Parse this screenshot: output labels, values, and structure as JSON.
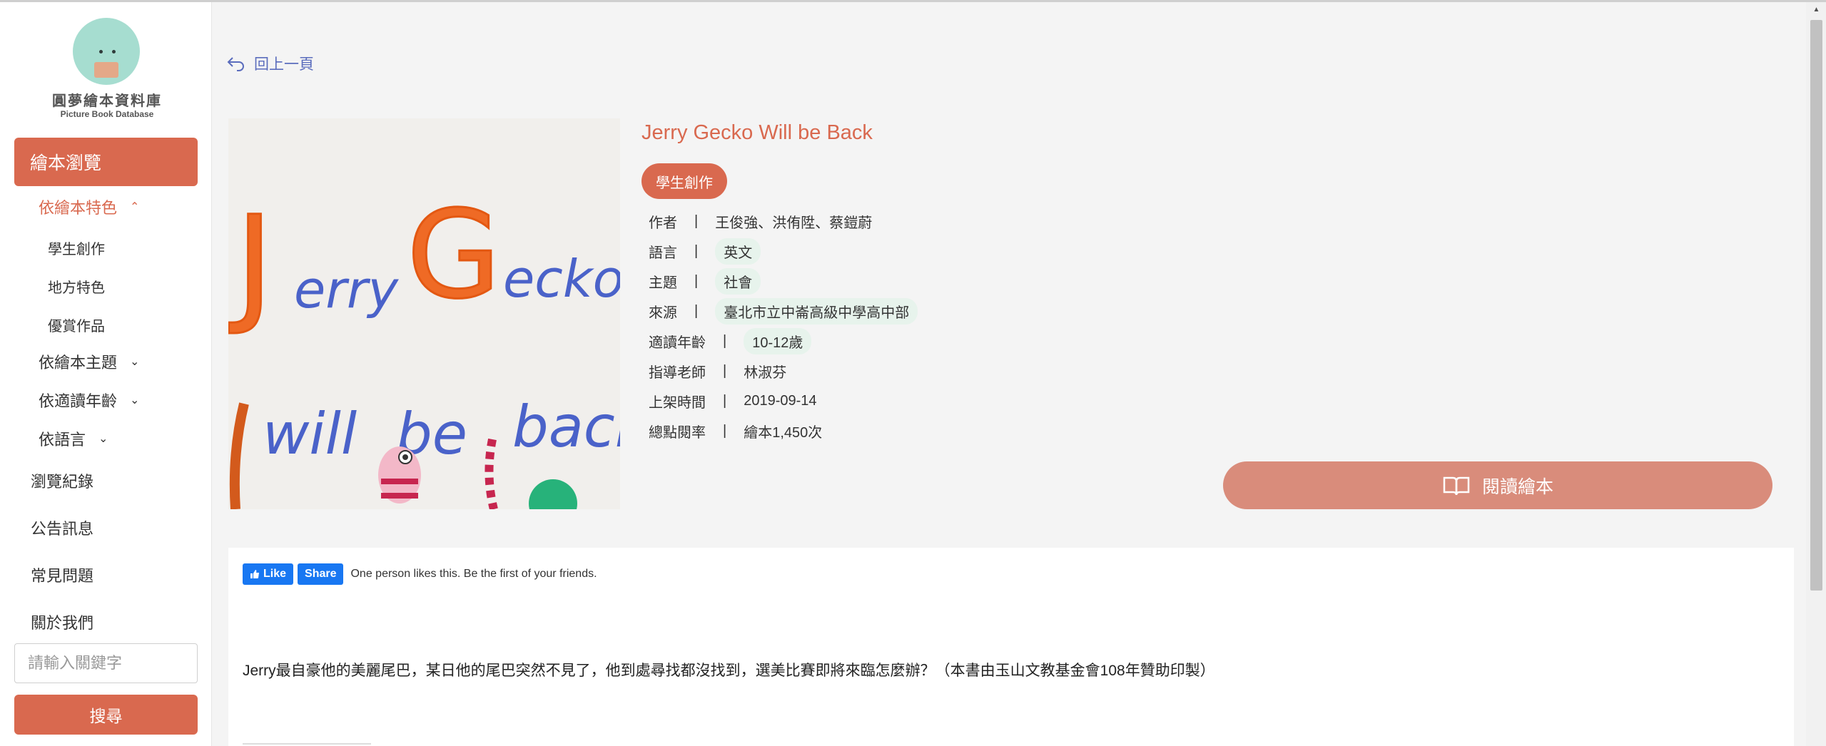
{
  "brand": {
    "title": "圓夢繪本資料庫",
    "subtitle": "Picture Book Database"
  },
  "sidebar": {
    "primary": "繪本瀏覽",
    "feature_group": "依繪本特色",
    "feature_items": [
      "學生創作",
      "地方特色",
      "優賞作品"
    ],
    "topic_group": "依繪本主題",
    "age_group": "依適讀年齡",
    "language_group": "依語言",
    "links": [
      "瀏覽紀錄",
      "公告訊息",
      "常見問題",
      "關於我們"
    ],
    "search_placeholder": "請輸入關鍵字",
    "search_button": "搜尋"
  },
  "back_link": "回上一頁",
  "book": {
    "title": "Jerry Gecko Will be Back",
    "category_tag": "學生創作",
    "cover_text": {
      "line1_a": "J",
      "line1_b": "erry",
      "line1_c": "G",
      "line1_d": "ecko",
      "line2_a": "will",
      "line2_b": "be",
      "line2_c": "back"
    },
    "meta": [
      {
        "label": "作者",
        "sep": "|",
        "value": "王俊強、洪侑陞、蔡鎧蔚",
        "chip": false
      },
      {
        "label": "語言",
        "sep": "|",
        "value": "英文",
        "chip": true
      },
      {
        "label": "主題",
        "sep": "|",
        "value": "社會",
        "chip": true
      },
      {
        "label": "來源",
        "sep": "|",
        "value": "臺北市立中崙高級中學高中部",
        "chip": true
      },
      {
        "label": "適讀年齡",
        "sep": "|",
        "value": "10-12歲",
        "chip": true
      },
      {
        "label": "指導老師",
        "sep": "|",
        "value": "林淑芬",
        "chip": false
      },
      {
        "label": "上架時間",
        "sep": "|",
        "value": "2019-09-14",
        "chip": false
      },
      {
        "label": "總點閱率",
        "sep": "|",
        "value": "繪本1,450次",
        "chip": false
      }
    ],
    "read_button": "閱讀繪本",
    "description": "Jerry最自豪他的美麗尾巴，某日他的尾巴突然不見了，他到處尋找都沒找到，選美比賽即將來臨怎麼辦？（本書由玉山文教基金會108年贊助印製）"
  },
  "facebook": {
    "like": "Like",
    "share": "Share",
    "text": "One person likes this. Be the first of your friends."
  },
  "colors": {
    "accent": "#d9694f",
    "read_button": "#d98c7b",
    "chip": "#e7f3ec",
    "link": "#5b6dbd",
    "fb": "#1877f2"
  }
}
